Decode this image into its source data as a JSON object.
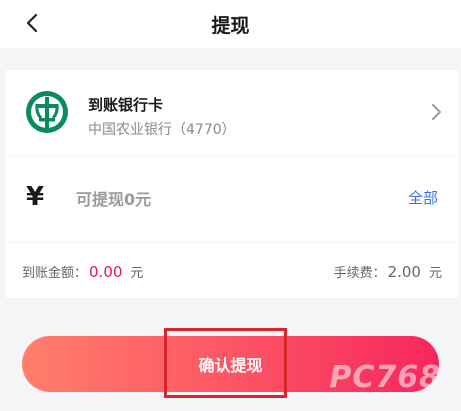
{
  "navbar": {
    "title": "提现"
  },
  "bank": {
    "title": "到账银行卡",
    "subtitle": "中国农业银行（4770）"
  },
  "amount": {
    "currency_symbol": "¥",
    "placeholder": "可提现0元",
    "all_label": "全部"
  },
  "fees": {
    "arrival_label": "到账金额：",
    "arrival_value": "0.00",
    "arrival_unit": "元",
    "fee_label": "手续费：",
    "fee_value": "2.00",
    "fee_unit": "元"
  },
  "confirm_label": "确认提现",
  "watermark": "PC768",
  "colors": {
    "accent_red": "#e5174c",
    "link_blue": "#3a73e8",
    "bank_green": "#0b8a62"
  },
  "icons": {
    "back": "chevron-left-icon",
    "bank": "abc-bank-logo",
    "next": "chevron-right-icon"
  }
}
